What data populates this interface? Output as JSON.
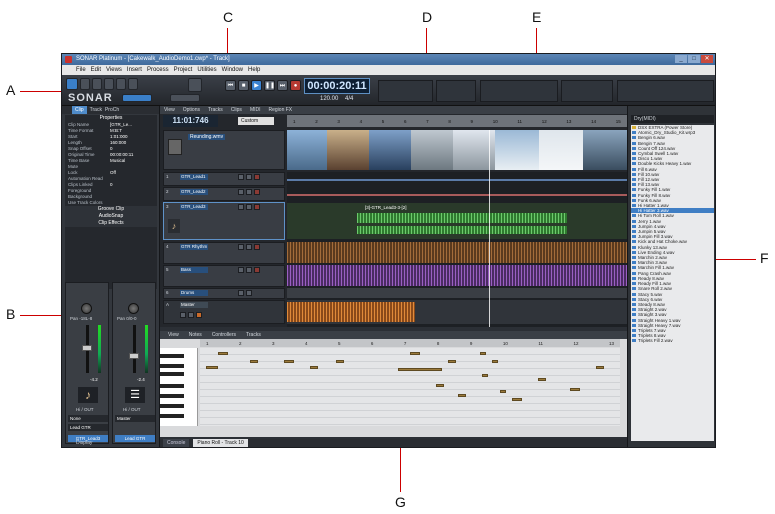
{
  "window": {
    "title": "SONAR Platinum - [Cakewalk_AudioDemo1.cwp* - Track]",
    "minimize": "_",
    "maximize": "□",
    "close": "✕"
  },
  "menu": [
    "File",
    "Edit",
    "Views",
    "Insert",
    "Process",
    "Project",
    "Utilities",
    "Window",
    "Help"
  ],
  "toolbar": {
    "logo": "SONAR",
    "time": "00:00:20:11",
    "tempo": "120.00",
    "meter": "4/4"
  },
  "inspector": {
    "tabs": [
      "Clip",
      "Track",
      "ProCh"
    ],
    "heading": "Properties",
    "props": [
      {
        "k": "Clip Name",
        "v": "[GTR_Le..."
      },
      {
        "k": "Time Format",
        "v": "M:B:T"
      },
      {
        "k": "Start",
        "v": "1:01:000"
      },
      {
        "k": "Length",
        "v": "160:000"
      },
      {
        "k": "Snap Offset",
        "v": "0"
      },
      {
        "k": "Original Time",
        "v": "00:00:00:11"
      },
      {
        "k": "Time Base",
        "v": "Musical"
      },
      {
        "k": "Mute",
        "v": ""
      },
      {
        "k": "Lock",
        "v": "Off"
      },
      {
        "k": "Automation Read",
        "v": ""
      },
      {
        "k": "Clips Linked",
        "v": "0"
      },
      {
        "k": "Foreground",
        "v": ""
      },
      {
        "k": "Background",
        "v": ""
      },
      {
        "k": "Use Track Colors",
        "v": ""
      }
    ],
    "sections": [
      "Groove Clip",
      "AudioSnap",
      "Clip Effects"
    ],
    "display_label": "Display"
  },
  "mixer": {
    "channels": [
      {
        "name": "GTR_Lead3",
        "pan": "Pan -18L-8",
        "vol": "-4.2",
        "num": "5",
        "io": "Hi / OUT",
        "input": "None",
        "output": "Lead GTR"
      },
      {
        "name": "Lead GTR",
        "pan": "Pan 0/0-0",
        "vol": "-2.4",
        "num": "C",
        "io": "Hi / OUT",
        "input": "Master",
        "output": ""
      }
    ]
  },
  "track_view": {
    "menus": [
      "View",
      "Options",
      "Tracks",
      "Clips",
      "MIDI",
      "Region FX"
    ],
    "now_time": "11:01:746",
    "group_label": "Custom",
    "ruler_marks": [
      "1",
      "2",
      "3",
      "4",
      "5",
      "6",
      "7",
      "8",
      "9",
      "10",
      "11",
      "12",
      "13",
      "14",
      "15"
    ],
    "video_track": "Reunding.wmv",
    "tracks": [
      {
        "num": "1",
        "name": "GTR_Lead1",
        "type": "audio"
      },
      {
        "num": "2",
        "name": "GTR_Lead2",
        "type": "audio"
      },
      {
        "num": "3",
        "name": "GTR_Lead3",
        "type": "audio"
      },
      {
        "num": "4",
        "name": "GTR Rhythm",
        "type": "audio"
      },
      {
        "num": "5",
        "name": "Bass",
        "type": "audio"
      },
      {
        "num": "6",
        "name": "Drums",
        "type": "audio"
      }
    ],
    "master_name": "Master",
    "master_letter": "A",
    "clip_label": "[3]-GTR_Lead3-3-[2]"
  },
  "piano_roll": {
    "menus": [
      "View",
      "Notes",
      "Controllers",
      "Tracks"
    ],
    "ruler_marks": [
      "1",
      "2",
      "3",
      "4",
      "5",
      "6",
      "7",
      "8",
      "9",
      "10",
      "11",
      "12",
      "13"
    ]
  },
  "browser": {
    "selector": "Dry(MIDI)",
    "items": [
      {
        "label": "DSX EXTRA (Power Store)",
        "folder": true
      },
      {
        "label": "Atomic_Dry_Studio_Kit.wrp3"
      },
      {
        "label": "Bengin 6.wav"
      },
      {
        "label": "Bengin 7.wav"
      },
      {
        "label": "Count Off 124.wav"
      },
      {
        "label": "Cymbal Swell 1.wav"
      },
      {
        "label": "Disco 1.wav"
      },
      {
        "label": "Double Kicks Heavy 1.wav"
      },
      {
        "label": "Fill 6.wav"
      },
      {
        "label": "Fill 10.wav"
      },
      {
        "label": "Fill 12.wav"
      },
      {
        "label": "Fill 13.wav"
      },
      {
        "label": "Funky Fill 1.wav"
      },
      {
        "label": "Funky Fill 8.wav"
      },
      {
        "label": "Funk 6.wav"
      },
      {
        "label": "Hi Hatter 1.wav"
      },
      {
        "label": "Hi Hatter 3.wav",
        "sel": true
      },
      {
        "label": "Hi Tom Roll 1.wav"
      },
      {
        "label": "Jerry 1.wav"
      },
      {
        "label": "Jumpin 4.wav"
      },
      {
        "label": "Jumpin 5.wav"
      },
      {
        "label": "Jumpin Fill 3.wav"
      },
      {
        "label": "Kick and Hat Choke.wav"
      },
      {
        "label": "Klunky 13.wav"
      },
      {
        "label": "Live Ending 4.wav"
      },
      {
        "label": "Marchin 2.wav"
      },
      {
        "label": "Marchin 3.wav"
      },
      {
        "label": "Marchin Fill 1.wav"
      },
      {
        "label": "Pang Crash.wav"
      },
      {
        "label": "Ready 8.wav"
      },
      {
        "label": "Ready Fill 1.wav"
      },
      {
        "label": "Snare Roll 2.wav"
      },
      {
        "label": "Stacy 5.wav"
      },
      {
        "label": "Stacy 6.wav"
      },
      {
        "label": "Steady 8.wav"
      },
      {
        "label": "Straight 2.wav"
      },
      {
        "label": "Straight 3.wav"
      },
      {
        "label": "Straight Heavy 1.wav"
      },
      {
        "label": "Straight Heavy 7.wav"
      },
      {
        "label": "Triplets 7.wav"
      },
      {
        "label": "Triplets 8.wav"
      },
      {
        "label": "Triplets Fill 2.wav"
      }
    ]
  },
  "bottom_tabs": [
    "Console",
    "Piano Roll - Track 10"
  ],
  "callouts": {
    "A": "A",
    "B": "B",
    "C": "C",
    "D": "D",
    "E": "E",
    "F": "F",
    "G": "G"
  },
  "colors": {
    "accent": "#3f7ec4",
    "callout": "#cc0000",
    "audio_green": "#4c8a3a",
    "audio_purple": "#7a4ca0",
    "audio_orange": "#c86a2a"
  }
}
